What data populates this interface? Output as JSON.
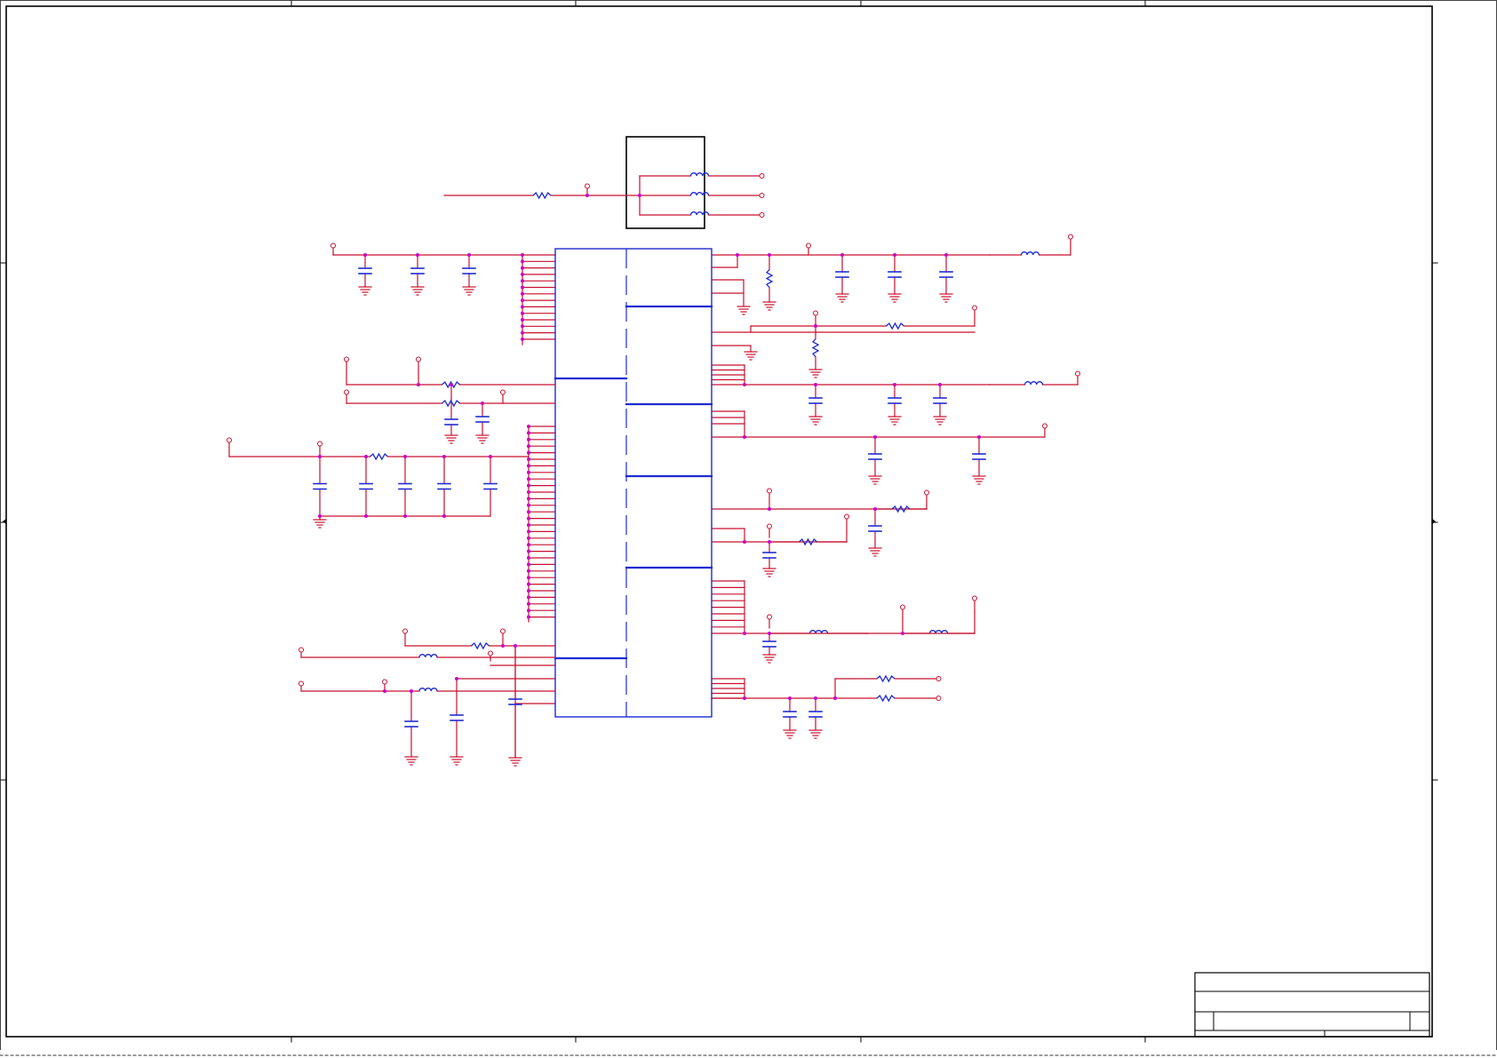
{
  "schematic": {
    "colors": {
      "wire": "#c8102e",
      "part": "#1f2bd1",
      "junction": "#cc00cc",
      "frame": "#000000",
      "paper": "#ffffff"
    },
    "symbol_names": [
      "resistor",
      "capacitor",
      "inductor",
      "ground",
      "power-port",
      "ic-body",
      "ferrite-bead"
    ],
    "title_block": {
      "visible": true,
      "text": []
    }
  }
}
